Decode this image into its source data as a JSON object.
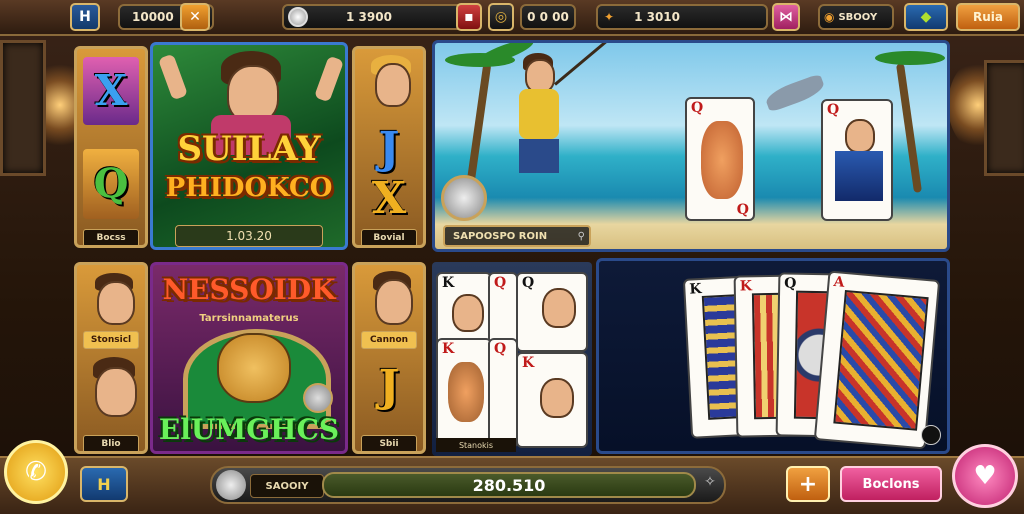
{
  "topbar": {
    "menu_icon": "H",
    "balance": "10000",
    "coins": "1 3900",
    "level": "0 0 00",
    "cash": "1 3010",
    "bonus": "SBOOY",
    "menu_label": "Ruia"
  },
  "panels": {
    "top_left_card": {
      "letter_top": "X",
      "letter_bottom": "Q",
      "caption": "Bocss"
    },
    "center_slot": {
      "line1": "SUILAY",
      "line2": "PHIDOKCO",
      "caption": "1.03.20"
    },
    "top_right_card": {
      "letter_top": "J",
      "letter_bottom": "X",
      "caption": "Bovial"
    },
    "beach_scene": {
      "caption": "SAPOOSPO ROIN",
      "card_left": "Q",
      "card_right": "Q"
    },
    "bottom_left_card": {
      "caption_top": "Stonsicl",
      "caption_bottom": "Blio"
    },
    "center_bottom": {
      "title": "NESSOIDK",
      "subtitle": "Tarrsinnamaterus",
      "footer": "ElUMGHCS"
    },
    "bottom_right_card": {
      "caption_top": "Cannon",
      "letter": "J",
      "caption_bottom": "Sbii"
    },
    "card_hand": {
      "caption": "Stanokis",
      "cards": [
        "K",
        "Q",
        "Q",
        "K",
        "Q",
        "K"
      ]
    },
    "card_fan": {
      "cards": [
        "K",
        "K",
        "Q",
        "A"
      ]
    }
  },
  "bottombar": {
    "search_label": "SAOOIY",
    "total": "280.510",
    "add_label": "+",
    "action_label": "Boclons"
  },
  "colors": {
    "accent": "#c9a25a",
    "gold": "#ffd23a",
    "pink": "#e8407a",
    "orange": "#f08a1a"
  }
}
